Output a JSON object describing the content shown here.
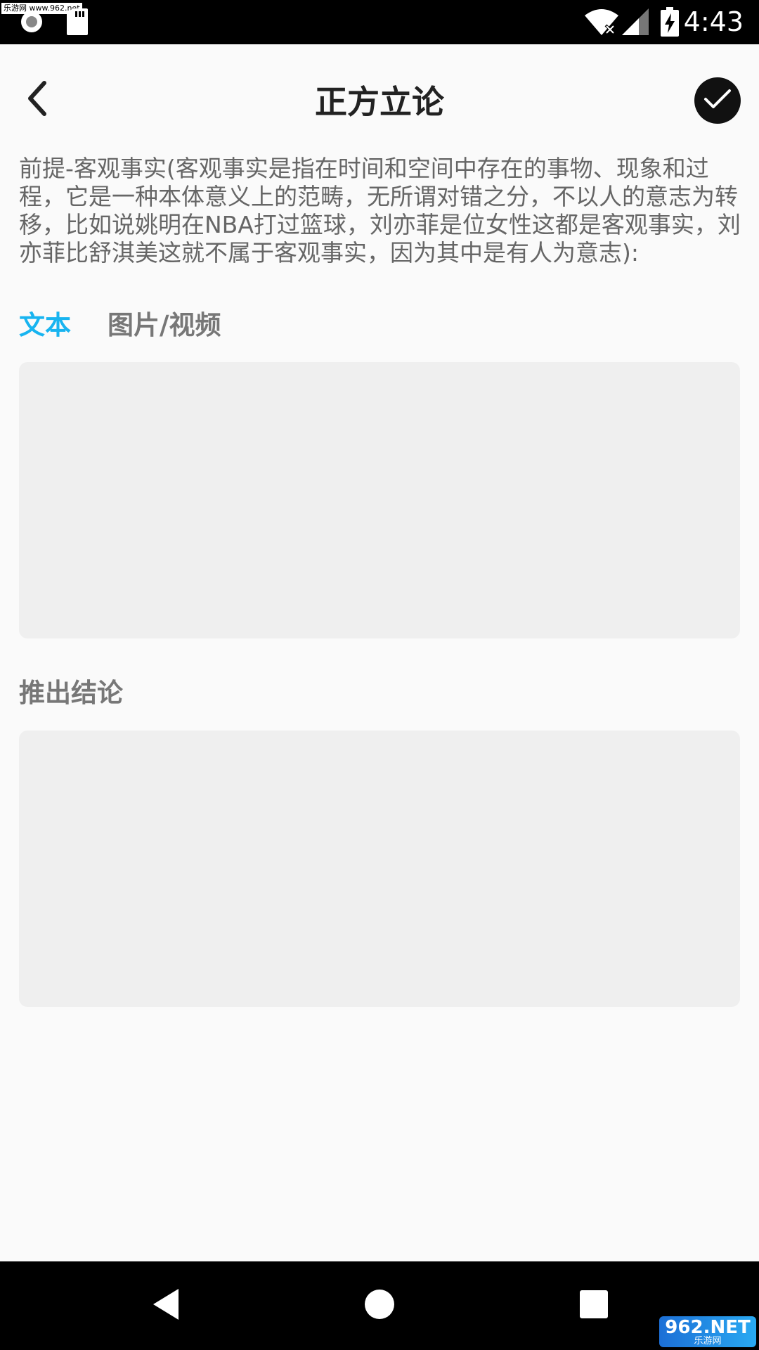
{
  "status_bar": {
    "watermark": "乐游网 www.962.net",
    "time": "4:43",
    "icons": [
      "record-icon",
      "sd-card-icon",
      "wifi-off-icon",
      "signal-icon",
      "battery-charging-icon"
    ]
  },
  "header": {
    "title": "正方立论",
    "back_icon": "chevron-left-icon",
    "confirm_icon": "check-icon"
  },
  "description": "前提-客观事实(客观事实是指在时间和空间中存在的事物、现象和过程，它是一种本体意义上的范畴，无所谓对错之分，不以人的意志为转移，比如说姚明在NBA打过篮球，刘亦菲是位女性这都是客观事实，刘亦菲比舒淇美这就不属于客观事实，因为其中是有人为意志):",
  "tabs": [
    {
      "label": "文本",
      "active": true
    },
    {
      "label": "图片/视频",
      "active": false
    }
  ],
  "premise_input": {
    "value": "",
    "placeholder": ""
  },
  "conclusion_label": "推出结论",
  "conclusion_input": {
    "value": "",
    "placeholder": ""
  },
  "nav_bar": {
    "icons": [
      "nav-back-icon",
      "nav-home-icon",
      "nav-recent-icon"
    ]
  },
  "logo": {
    "main": "962.NET",
    "sub": "乐游网"
  },
  "colors": {
    "accent": "#18b4f0",
    "background": "#fafafa",
    "input_bg": "#efefef"
  }
}
